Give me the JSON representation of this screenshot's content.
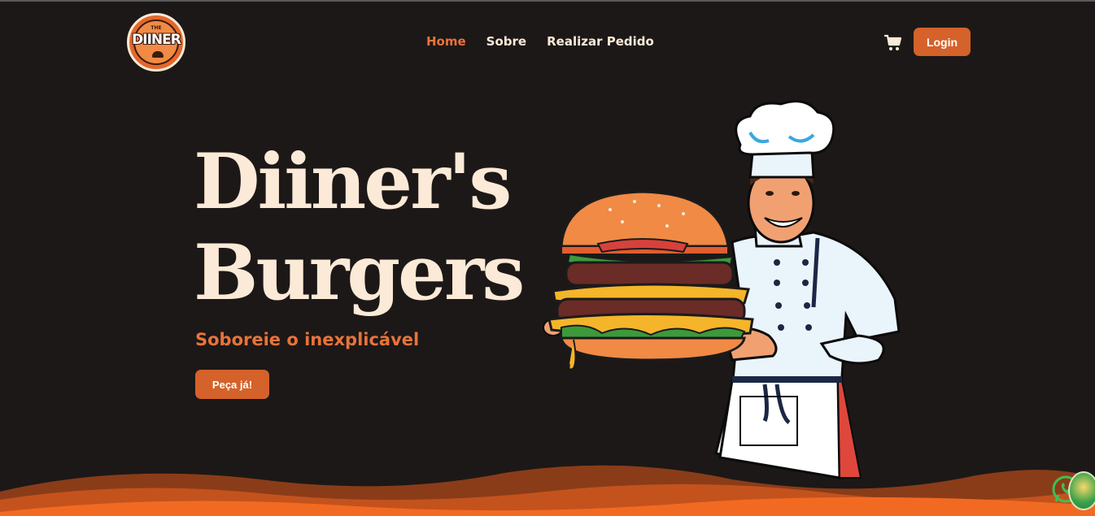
{
  "logo": {
    "word": "DIINER",
    "small": "THE"
  },
  "nav": {
    "items": [
      {
        "label": "Home",
        "active": true
      },
      {
        "label": "Sobre",
        "active": false
      },
      {
        "label": "Realizar Pedido",
        "active": false
      }
    ]
  },
  "header": {
    "cart_icon": "cart-icon",
    "login_label": "Login"
  },
  "hero": {
    "title_line1": "Diiner's",
    "title_line2": "Burgers",
    "subtitle": "Soboreie o inexplicável",
    "cta_label": "Peça já!",
    "image": "chef-holding-burger-illustration"
  },
  "colors": {
    "background": "#1c1817",
    "accent": "#e8733a",
    "button": "#d4622a",
    "cream": "#fbead7",
    "wave": "#f26a22"
  }
}
